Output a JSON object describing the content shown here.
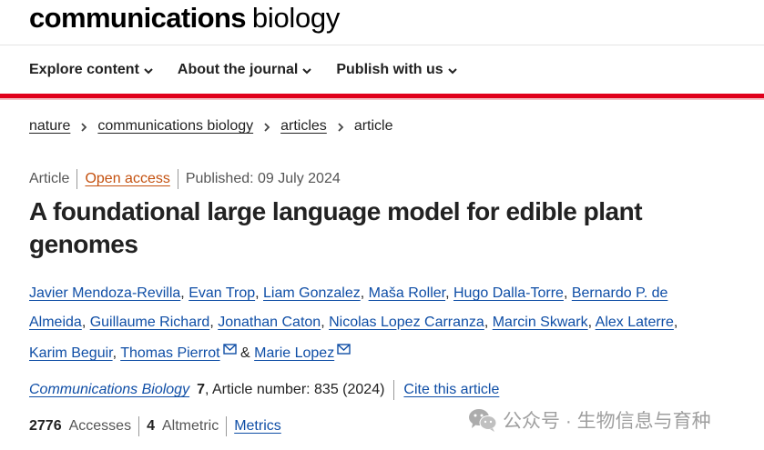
{
  "brand": {
    "part1": "communications",
    "part2": "biology"
  },
  "nav": [
    {
      "label": "Explore content"
    },
    {
      "label": "About the journal"
    },
    {
      "label": "Publish with us"
    }
  ],
  "breadcrumb": [
    {
      "label": "nature"
    },
    {
      "label": "communications biology"
    },
    {
      "label": "articles"
    },
    {
      "label": "article"
    }
  ],
  "meta": {
    "type": "Article",
    "access": "Open access",
    "published": "Published: 09 July 2024"
  },
  "title": "A foundational large language model for edible plant genomes",
  "authors": [
    "Javier Mendoza-Revilla",
    "Evan Trop",
    "Liam Gonzalez",
    "Maša Roller",
    "Hugo Dalla-Torre",
    "Bernardo P. de Almeida",
    "Guillaume Richard",
    "Jonathan Caton",
    "Nicolas Lopez Carranza",
    "Marcin Skwark",
    "Alex Laterre",
    "Karim Beguir",
    "Thomas Pierrot",
    "Marie Lopez"
  ],
  "separators": {
    "comma": ",",
    "amp": "&"
  },
  "citation": {
    "journal": "Communications Biology",
    "volume": "7",
    "article_number": ", Article number: 835 (2024)",
    "cite_label": "Cite this article"
  },
  "metrics": {
    "accesses_count": "2776",
    "accesses_label": "Accesses",
    "altmetric_count": "4",
    "altmetric_label": "Altmetric",
    "metrics_link": "Metrics"
  },
  "watermark": {
    "text": "公众号 · 生物信息与育种",
    "icon": "wechat-icon"
  },
  "colors": {
    "accent_red": "#e0001b",
    "link_blue": "#0f4ea6",
    "open_access_orange": "#c4510f"
  },
  "icons": {
    "nav_chevron": "chevron-down-icon",
    "breadcrumb_sep": "chevron-right-icon",
    "author_mail": "mail-icon"
  }
}
